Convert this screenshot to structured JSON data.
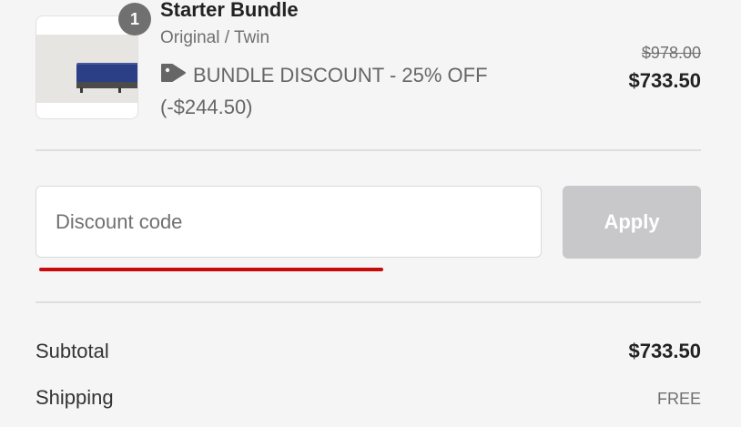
{
  "line_item": {
    "quantity": "1",
    "title": "Starter Bundle",
    "variant": "Original / Twin",
    "discount_icon": "tag-icon",
    "discount_label": "BUNDLE DISCOUNT - 25% OFF",
    "discount_amount": "(-$244.50)",
    "original_price": "$978.00",
    "final_price": "$733.50"
  },
  "discount_form": {
    "placeholder": "Discount code",
    "value": "",
    "apply_label": "Apply",
    "apply_color": "#c8c7ca",
    "underline_color": "#c90a0a"
  },
  "summary": {
    "subtotal_label": "Subtotal",
    "subtotal_value": "$733.50",
    "shipping_label": "Shipping",
    "shipping_value": "FREE"
  }
}
